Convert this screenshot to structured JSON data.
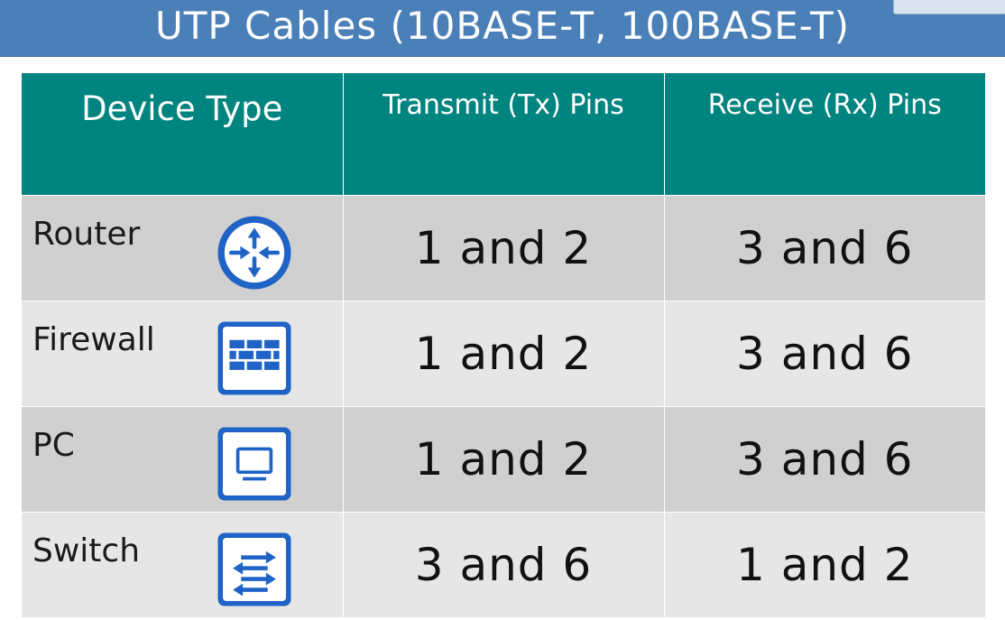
{
  "title": "UTP Cables (10BASE-T, 100BASE-T)",
  "table": {
    "headers": {
      "device": "Device Type",
      "tx": "Transmit (Tx) Pins",
      "rx": "Receive (Rx) Pins"
    },
    "rows": [
      {
        "device": "Router",
        "icon": "router-icon",
        "tx": "1 and 2",
        "rx": "3 and 6"
      },
      {
        "device": "Firewall",
        "icon": "firewall-icon",
        "tx": "1 and 2",
        "rx": "3 and 6"
      },
      {
        "device": "PC",
        "icon": "pc-icon",
        "tx": "1 and 2",
        "rx": "3 and 6"
      },
      {
        "device": "Switch",
        "icon": "switch-icon",
        "tx": "3 and 6",
        "rx": "1 and 2"
      }
    ]
  },
  "colors": {
    "title_bar": "#4a7fb8",
    "header": "#00847f",
    "row_dark": "#d0d0d0",
    "row_light": "#e6e6e6",
    "icon_blue": "#1f63c6"
  }
}
